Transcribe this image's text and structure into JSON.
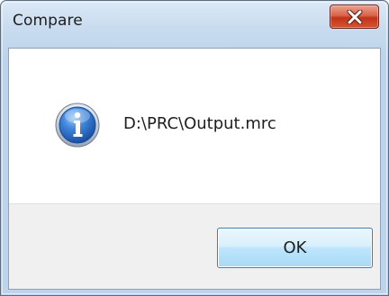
{
  "window": {
    "title": "Compare"
  },
  "titlebar": {
    "close_icon": "close-x-icon"
  },
  "message": {
    "icon": "information-icon",
    "text": "D:\\PRC\\Output.mrc"
  },
  "buttons": {
    "ok_label": "OK"
  },
  "colors": {
    "titlebar_frame": "#c9dcef",
    "close_button": "#c1341a",
    "info_icon_blue": "#2a6fc9",
    "ok_button_border": "#3c7fb1",
    "button_panel": "#f0f0f0"
  }
}
